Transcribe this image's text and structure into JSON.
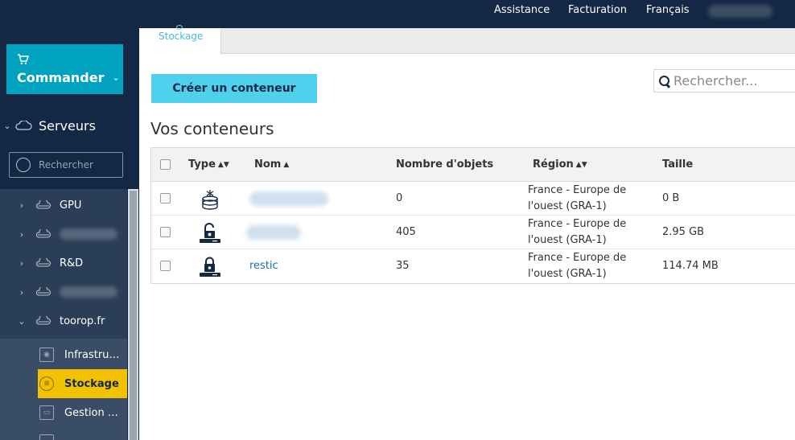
{
  "topbar": {
    "links": [
      "Assistance",
      "Facturation",
      "Français"
    ]
  },
  "sidebar": {
    "order_button": {
      "label": "Commander",
      "icon": "cart-icon"
    },
    "section": {
      "label": "Serveurs",
      "icon": "cloud-icon"
    },
    "search_placeholder": "Rechercher",
    "items": [
      {
        "label": "GPU"
      },
      {
        "label": ""
      },
      {
        "label": "R&D"
      },
      {
        "label": ""
      },
      {
        "label": "toorop.fr"
      }
    ],
    "subitems": [
      {
        "label": "Infrastructure",
        "icon": "network-icon"
      },
      {
        "label": "Stockage",
        "icon": "database-icon"
      },
      {
        "label": "Gestion des clés",
        "icon": "window-icon"
      }
    ]
  },
  "main": {
    "active_tab": "Stockage",
    "create_button": "Créer un conteneur",
    "search_placeholder": "Rechercher...",
    "title": "Vos conteneurs",
    "columns": [
      "Type",
      "Nom",
      "Nombre d'objets",
      "Région",
      "Taille"
    ],
    "rows": [
      {
        "type_icon": "cold-storage-icon",
        "name": "",
        "objects": "0",
        "region_line1": "France - Europe de",
        "region_line2": "l'ouest (GRA-1)",
        "size": "0 B"
      },
      {
        "type_icon": "public-container-icon",
        "name": "",
        "objects": "405",
        "region_line1": "France - Europe de",
        "region_line2": "l'ouest (GRA-1)",
        "size": "2.95 GB"
      },
      {
        "type_icon": "private-container-icon",
        "name": "restic",
        "objects": "35",
        "region_line1": "France - Europe de",
        "region_line2": "l'ouest (GRA-1)",
        "size": "114.74 MB"
      }
    ]
  },
  "colors": {
    "navy": "#122844",
    "cyan": "#00a2bf",
    "highlight": "#f2c200",
    "button": "#4fd1ee",
    "link": "#1f6fa8"
  }
}
